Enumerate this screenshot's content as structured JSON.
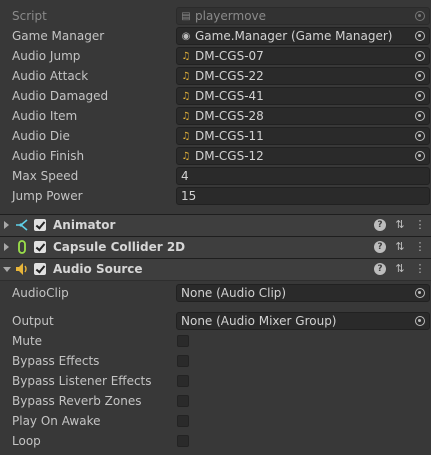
{
  "script_row": {
    "label": "Script",
    "value": "playermove"
  },
  "fields": [
    {
      "label": "Game Manager",
      "value": "Game.Manager (Game Manager)",
      "icon": "gameobject-icon"
    },
    {
      "label": "Audio Jump",
      "value": "DM-CGS-07",
      "icon": "audio-clip-icon"
    },
    {
      "label": "Audio Attack",
      "value": "DM-CGS-22",
      "icon": "audio-clip-icon"
    },
    {
      "label": "Audio Damaged",
      "value": "DM-CGS-41",
      "icon": "audio-clip-icon"
    },
    {
      "label": "Audio Item",
      "value": "DM-CGS-28",
      "icon": "audio-clip-icon"
    },
    {
      "label": "Audio Die",
      "value": "DM-CGS-11",
      "icon": "audio-clip-icon"
    },
    {
      "label": "Audio Finish",
      "value": "DM-CGS-12",
      "icon": "audio-clip-icon"
    }
  ],
  "max_speed": {
    "label": "Max Speed",
    "value": "4"
  },
  "jump_power": {
    "label": "Jump Power",
    "value": "15"
  },
  "components": [
    {
      "title": "Animator",
      "icon": "animator-icon",
      "enabled": true,
      "expanded": false
    },
    {
      "title": "Capsule Collider 2D",
      "icon": "capsule-collider-icon",
      "enabled": true,
      "expanded": false
    },
    {
      "title": "Audio Source",
      "icon": "audio-source-icon",
      "enabled": true,
      "expanded": true
    }
  ],
  "audio_source": {
    "audio_clip": {
      "label": "AudioClip",
      "value": "None (Audio Clip)"
    },
    "output": {
      "label": "Output",
      "value": "None (Audio Mixer Group)"
    },
    "toggles": [
      {
        "label": "Mute",
        "checked": false
      },
      {
        "label": "Bypass Effects",
        "checked": false
      },
      {
        "label": "Bypass Listener Effects",
        "checked": false
      },
      {
        "label": "Bypass Reverb Zones",
        "checked": false
      },
      {
        "label": "Play On Awake",
        "checked": false
      },
      {
        "label": "Loop",
        "checked": false
      }
    ]
  },
  "colors": {
    "background": "#383838",
    "header": "#3e3e3e",
    "field": "#2a2a2a",
    "audio_icon": "#e8b53a",
    "collider_icon": "#9be04a",
    "animator_icon": "#5fd0e8"
  }
}
